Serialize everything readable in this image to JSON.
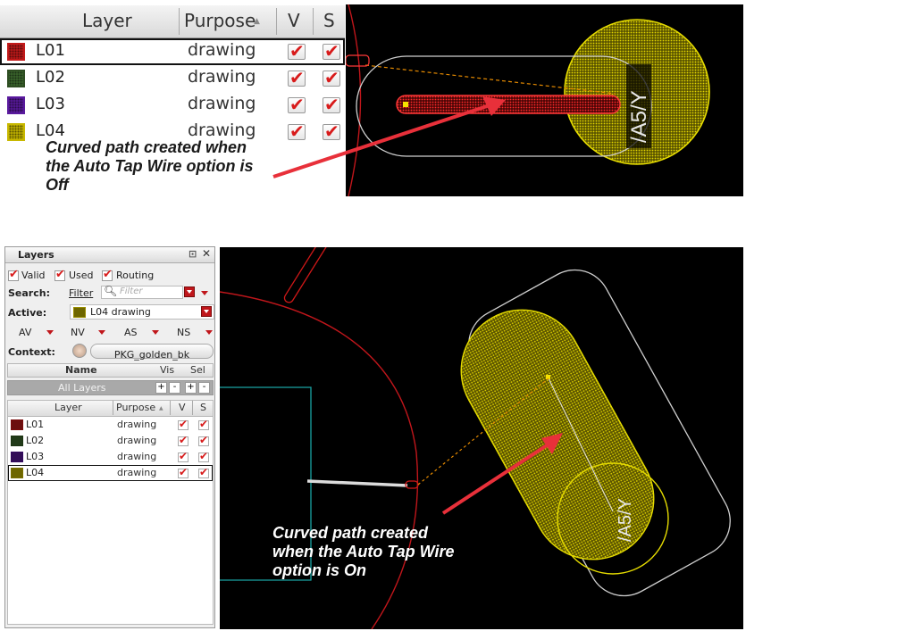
{
  "top_table": {
    "headers": {
      "layer": "Layer",
      "purpose": "Purpose",
      "v": "V",
      "s": "S"
    },
    "rows": [
      {
        "name": "L01",
        "purpose": "drawing",
        "color": "#c21a1a"
      },
      {
        "name": "L02",
        "purpose": "drawing",
        "color": "#3c6a2e"
      },
      {
        "name": "L03",
        "purpose": "drawing",
        "color": "#5a1a9e"
      },
      {
        "name": "L04",
        "purpose": "drawing",
        "color": "#c8b800"
      }
    ]
  },
  "caption_off": {
    "line1": "Curved path created when",
    "line2": "the Auto Tap Wire option is",
    "line3": "Off"
  },
  "top_canvas": {
    "label": "/A5/Y"
  },
  "layers_panel": {
    "title": "Layers",
    "filters": {
      "valid": "Valid",
      "used": "Used",
      "routing": "Routing"
    },
    "search_label": "Search:",
    "filter_button": "Filter",
    "filter_placeholder": "Filter",
    "active_label": "Active:",
    "active_value": "L04 drawing",
    "visibility_dropdowns": [
      "AV",
      "NV",
      "AS",
      "NS"
    ],
    "context_label": "Context:",
    "context_value": "PKG_golden_bk",
    "name_headers": {
      "name": "Name",
      "vis": "Vis",
      "sel": "Sel"
    },
    "all_layers": "All Layers",
    "headers": {
      "layer": "Layer",
      "purpose": "Purpose",
      "v": "V",
      "s": "S"
    },
    "rows": [
      {
        "name": "L01",
        "purpose": "drawing",
        "color": "#c21a1a"
      },
      {
        "name": "L02",
        "purpose": "drawing",
        "color": "#3c6a2e"
      },
      {
        "name": "L03",
        "purpose": "drawing",
        "color": "#5a1a9e"
      },
      {
        "name": "L04",
        "purpose": "drawing",
        "color": "#c8b800"
      }
    ]
  },
  "bottom_canvas": {
    "label": "/A5/Y"
  },
  "caption_on": {
    "line1": "Curved path created",
    "line2": "when the Auto Tap Wire",
    "line3": "option is On"
  },
  "colors": {
    "canvas": "#000000",
    "arrow": "#e8303a",
    "pad": "#d6c800",
    "route": "#d8151b"
  }
}
